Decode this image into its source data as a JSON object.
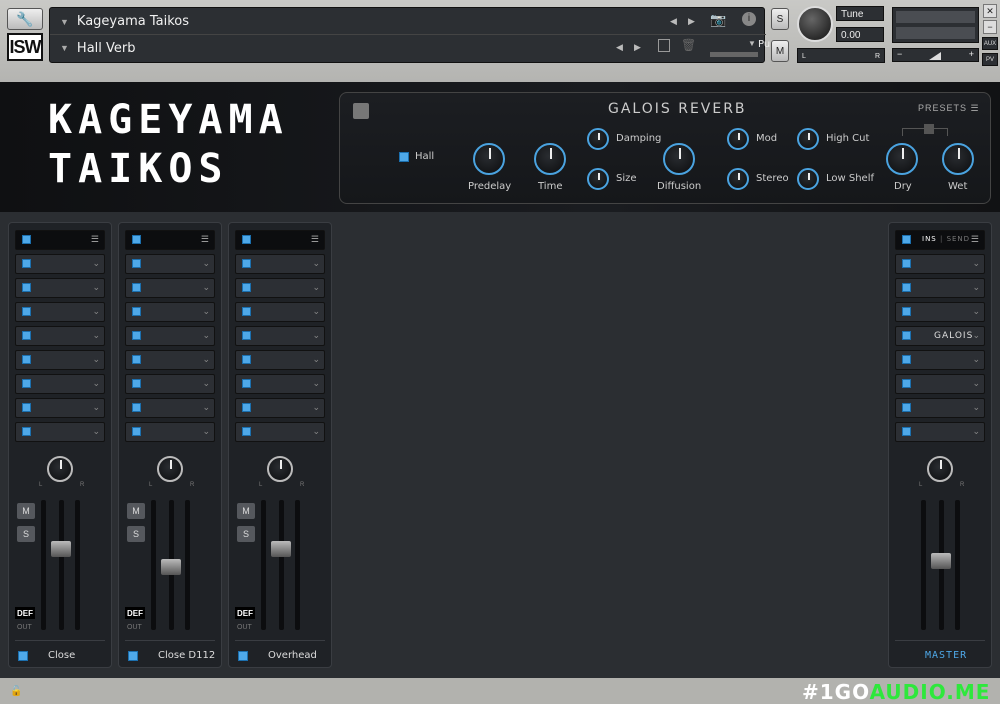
{
  "header": {
    "instrument_name": "Kageyama Taikos",
    "snapshot_name": "Hall Verb",
    "logo_text": "ISW",
    "purge_label": "Purge",
    "solo_label": "S",
    "mute_label": "M",
    "tune_label": "Tune",
    "tune_value": "0.00",
    "pan_left": "L",
    "pan_right": "R",
    "vol_minus": "−",
    "vol_plus": "+",
    "aux_label": "AUX",
    "pv_label": "PV",
    "close_label": "✕",
    "min_label": "−"
  },
  "title": {
    "line1": "KAGEYAMA",
    "line2": "TAIKOS"
  },
  "reverb": {
    "title": "GALOIS REVERB",
    "presets_label": "PRESETS",
    "mode_label": "Hall",
    "knobs": {
      "predelay": "Predelay",
      "time": "Time",
      "damping": "Damping",
      "size": "Size",
      "diffusion": "Diffusion",
      "mod": "Mod",
      "stereo": "Stereo",
      "high_cut": "High Cut",
      "low_shelf": "Low Shelf",
      "dry": "Dry",
      "wet": "Wet"
    }
  },
  "strips": [
    {
      "name": "Close",
      "out": "OUT",
      "def": "DEF",
      "m": "M",
      "s": "S",
      "l": "L",
      "r": "R"
    },
    {
      "name": "Close D112",
      "out": "OUT",
      "def": "DEF",
      "m": "M",
      "s": "S",
      "l": "L",
      "r": "R"
    },
    {
      "name": "Overhead",
      "out": "OUT",
      "def": "DEF",
      "m": "M",
      "s": "S",
      "l": "L",
      "r": "R"
    }
  ],
  "master": {
    "name": "MASTER",
    "ins": "INS",
    "send": "SEND",
    "slot_galois": "GALOIS",
    "l": "L",
    "r": "R"
  },
  "colors": {
    "accent": "#4ea8e8",
    "background": "#2b2e32"
  },
  "watermark": {
    "part1": "#1GO",
    "part2": "AUDIO.ME"
  }
}
